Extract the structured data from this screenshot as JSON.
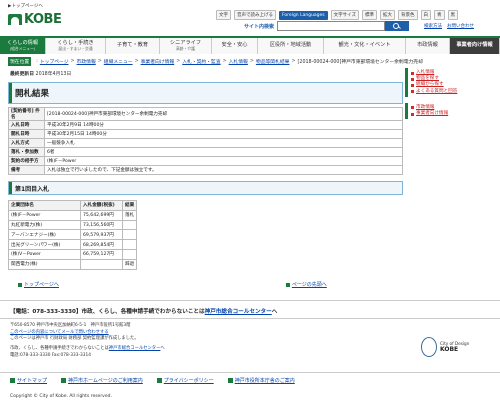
{
  "skip_link": "▶トップページへ",
  "logo_text": "KOBE",
  "utilities": {
    "text_size": "文字",
    "audio": "音声で読み上げる",
    "languages": "Foreign Languages",
    "char_size": "文字サイズ",
    "standard": "標準",
    "enlarge": "拡大",
    "color": "背景色",
    "white": "白",
    "blue": "青",
    "black": "黒"
  },
  "search": {
    "label": "サイト内検索",
    "placeholder": "",
    "howto": "検索方法",
    "inquiry": "お問い合わせ"
  },
  "gnav": [
    {
      "label": "くらしの情報",
      "sub": "(組合メニュー)"
    },
    {
      "label": "くらし・手続き",
      "sub": "届出・すまい・交通"
    },
    {
      "label": "子育て・教育",
      "sub": ""
    },
    {
      "label": "シニアライフ",
      "sub": "高齢・介護"
    },
    {
      "label": "安全・安心",
      "sub": ""
    },
    {
      "label": "区役所・地域活動",
      "sub": ""
    },
    {
      "label": "観光・文化・イベント",
      "sub": ""
    },
    {
      "label": "市政情報",
      "sub": ""
    },
    {
      "label": "事業者向け情報",
      "sub": ""
    }
  ],
  "breadcrumb": {
    "current_marker": "現在位置",
    "items": [
      "トップページ",
      "市政情報",
      "組織メニュー",
      "事業者向け情報",
      "入札・契約・監査",
      "入札情報",
      "物品等関札結果"
    ],
    "current": "[2018-00024-000]神戸市東部環境センター余剰電力売却"
  },
  "updated": {
    "label": "最終更新日",
    "value": "2018年4月13日"
  },
  "page_title": "開札結果",
  "info_rows": [
    {
      "key": "[契約番号] 件名",
      "value": "[2018-00024-000]神戸市東部環境センター余剰電力売却"
    },
    {
      "key": "入札日時",
      "value": "平成30年2月9日 14時00分"
    },
    {
      "key": "開札日時",
      "value": "平成30年2月15日 14時00分"
    },
    {
      "key": "入札方式",
      "value": "一般競争入札"
    },
    {
      "key": "落札・参加数",
      "value": "6者"
    },
    {
      "key": "契約の相手方",
      "value": "(株)F－Power"
    },
    {
      "key": "備考",
      "value": "入札は独立で行いましたので、下記金額は独立です。"
    }
  ],
  "section_title": "第1回目入札",
  "bid_table": {
    "headers": [
      "企業団体名",
      "入札金額(税抜)",
      "結果"
    ],
    "rows": [
      [
        "(株)F－Power",
        "75,642,699円",
        "落札"
      ],
      [
        "丸紅新電力(株)",
        "73,156,560円",
        ""
      ],
      [
        "アーバンエナジー(株)",
        "69,579,937円",
        ""
      ],
      [
        "出光グリーンパワー(株)",
        "68,269,854円",
        ""
      ],
      [
        "(株)V－Power",
        "66,759,127円",
        ""
      ],
      [
        "関西電力(株)",
        "",
        "辞退"
      ]
    ]
  },
  "nav_links": {
    "top": "トップページへ",
    "back": "ページの先頭へ"
  },
  "side": {
    "group1": [
      "入札情報",
      "物品を探す",
      "組織から探す",
      "よくある質問と回答"
    ],
    "group2": [
      "市政情報",
      "事業者向け情報"
    ]
  },
  "callcenter": {
    "text_before": "【電話：078-333-3330】市政、くらし、各種申請手続でわからないことは",
    "link": "神戸市総合コールセンター",
    "text_after": "へ"
  },
  "address": {
    "line1": "〒650-8570 神戸市中央区加納町6-5-1　神戸市役所1号館3階",
    "line2_link": "このページの内容についてメールで問い合わせする",
    "line3": "このページは神戸市 行財政局 財務部 契約監理課が作成しました。",
    "line4_before": "市政、くらし、各種申請手続きでわからないことは",
    "line4_link": "神戸市総合コールセンター",
    "line4_after": "へ",
    "line5": "電話:078-333-3330 Fax:078-333-3314"
  },
  "ud_badge": {
    "title": "City of Design",
    "name": "KOBE"
  },
  "footer_links": [
    "サイトマップ",
    "神戸市ホームページのご利用案内",
    "プライバシーポリシー",
    "神戸市役所本庁舎のご案内"
  ],
  "copyright": "Copyright © City of Kobe. All rights reserved.",
  "colors": {
    "brand_green": "#1b7a3d",
    "link_blue": "#0645ad",
    "heading_border": "#7fb6d5"
  }
}
